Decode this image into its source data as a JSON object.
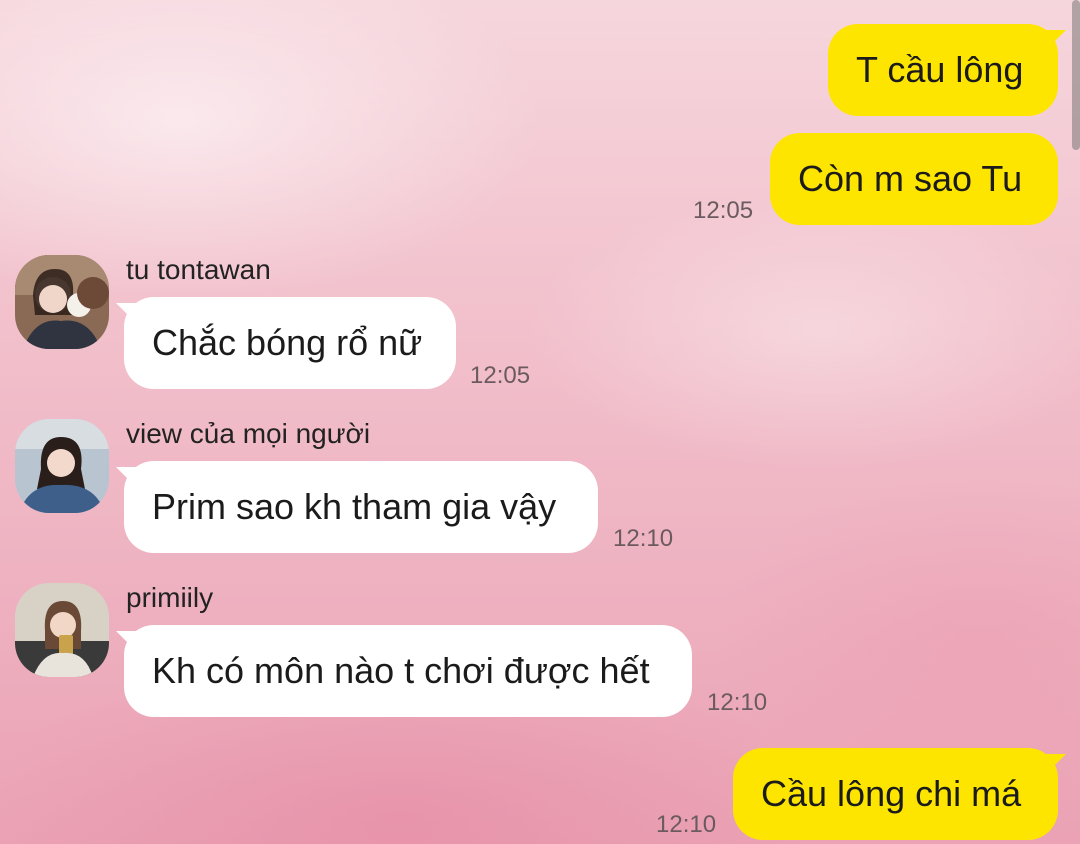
{
  "messages": [
    {
      "direction": "outgoing",
      "text": "T cầu lông"
    },
    {
      "direction": "outgoing",
      "text": "Còn m sao Tu",
      "time": "12:05"
    },
    {
      "direction": "incoming",
      "sender": "tu tontawan",
      "avatar_icon": "user-avatar-photo",
      "text": "Chắc bóng rổ nữ",
      "time": "12:05"
    },
    {
      "direction": "incoming",
      "sender": "view của mọi người",
      "avatar_icon": "user-avatar-photo",
      "text": "Prim sao kh tham gia vậy",
      "time": "12:10"
    },
    {
      "direction": "incoming",
      "sender": "primiily",
      "avatar_icon": "user-avatar-photo",
      "text": "Kh có môn nào t chơi được hết",
      "time": "12:10"
    },
    {
      "direction": "outgoing",
      "text": "Cầu lông chi má",
      "time": "12:10"
    }
  ],
  "colors": {
    "outgoing_bubble": "#fee500",
    "incoming_bubble": "#ffffff",
    "background": "#f2c2cd"
  }
}
